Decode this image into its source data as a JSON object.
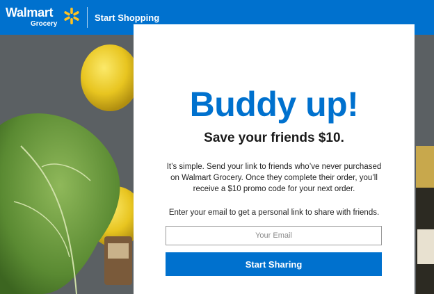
{
  "header": {
    "brand_name": "Walmart",
    "brand_sub": "Grocery",
    "nav_link": "Start Shopping"
  },
  "modal": {
    "headline": "Buddy up!",
    "subhead": "Save your friends $10.",
    "body": "It’s simple. Send your link to friends who’ve never purchased on Walmart Grocery. Once they complete their order, you’ll receive a $10 promo code for your next order.",
    "email_prompt": "Enter your email to get a personal link to share with friends.",
    "email_placeholder": "Your Email",
    "email_value": "",
    "cta_label": "Start Sharing"
  },
  "colors": {
    "brand_blue": "#0071ce",
    "spark_yellow": "#ffc220"
  }
}
